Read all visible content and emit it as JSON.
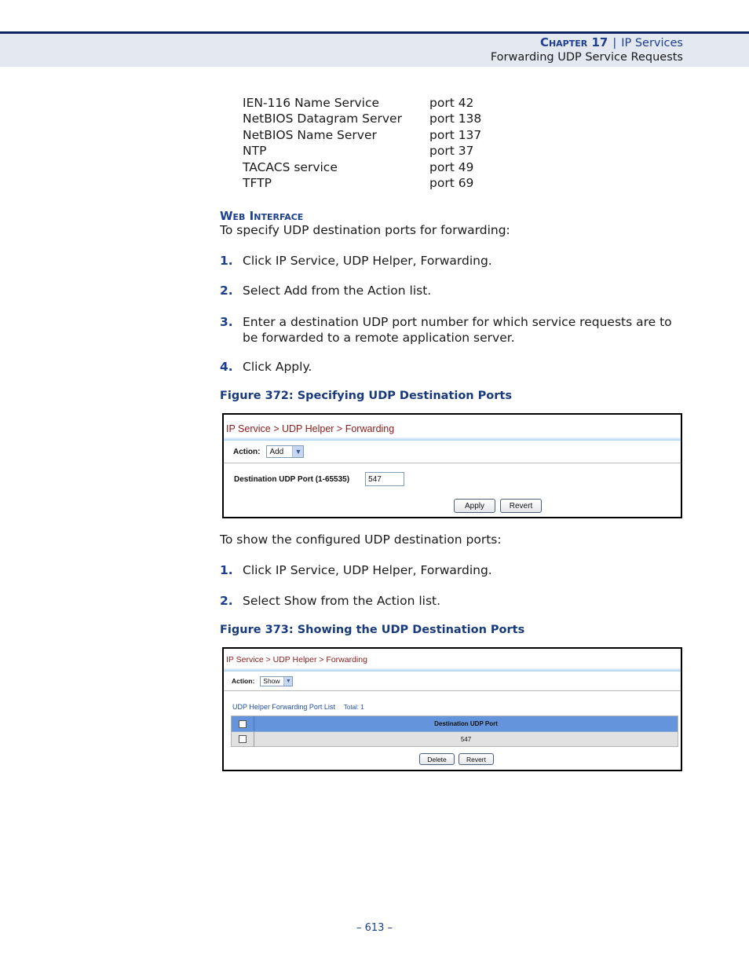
{
  "header": {
    "chapter_label": "Chapter 17",
    "separator": "|",
    "chapter_title": "IP Services",
    "section_title": "Forwarding UDP Service Requests"
  },
  "port_list": [
    {
      "service": "IEN-116 Name Service",
      "port": "port 42"
    },
    {
      "service": "NetBIOS Datagram Server",
      "port": "port 138"
    },
    {
      "service": "NetBIOS Name Server",
      "port": "port 137"
    },
    {
      "service": "NTP",
      "port": "port 37"
    },
    {
      "service": "TACACS service",
      "port": "port 49"
    },
    {
      "service": "TFTP",
      "port": "port 69"
    }
  ],
  "web_interface": {
    "heading": "Web Interface",
    "intro_specify": "To specify UDP destination ports for forwarding:",
    "steps_specify": [
      {
        "num": "1.",
        "text": "Click IP Service, UDP Helper, Forwarding."
      },
      {
        "num": "2.",
        "text": "Select Add from the Action list."
      },
      {
        "num": "3.",
        "text": "Enter a destination UDP port number for which service requests are to be forwarded to a remote application server."
      },
      {
        "num": "4.",
        "text": "Click Apply."
      }
    ],
    "intro_show": "To show the configured UDP destination ports:",
    "steps_show": [
      {
        "num": "1.",
        "text": "Click IP Service, UDP Helper, Forwarding."
      },
      {
        "num": "2.",
        "text": "Select Show from the Action list."
      }
    ]
  },
  "figure_372": {
    "caption": "Figure 372:  Specifying UDP Destination Ports",
    "breadcrumb": "IP Service > UDP Helper > Forwarding",
    "action_label": "Action:",
    "action_value": "Add",
    "dest_port_label": "Destination UDP Port (1-65535)",
    "dest_port_value": "547",
    "apply_label": "Apply",
    "revert_label": "Revert"
  },
  "figure_373": {
    "caption": "Figure 373:  Showing the UDP Destination Ports",
    "breadcrumb": "IP Service > UDP Helper > Forwarding",
    "action_label": "Action:",
    "action_value": "Show",
    "list_title": "UDP Helper Forwarding Port List",
    "list_total": "Total: 1",
    "column_header": "Destination UDP Port",
    "rows": [
      {
        "port": "547"
      }
    ],
    "delete_label": "Delete",
    "revert_label": "Revert"
  },
  "footer": {
    "page_number": "–  613  –"
  }
}
